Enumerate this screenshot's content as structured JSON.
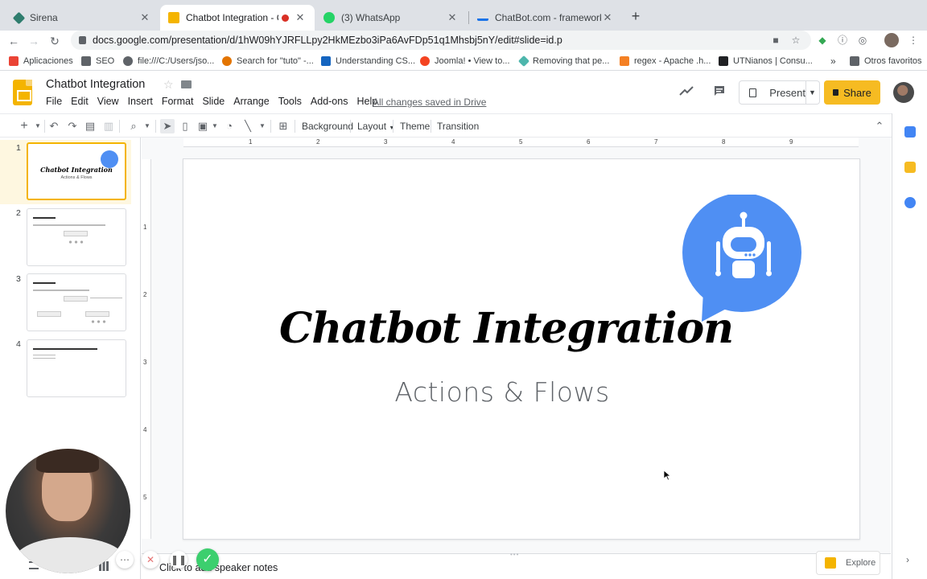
{
  "browser": {
    "tabs": [
      {
        "title": "Sirena",
        "color": "#2f7d6e"
      },
      {
        "title": "Chatbot Integration - Goog",
        "color": "#f4b400"
      },
      {
        "title": "(3) WhatsApp",
        "color": "#25d366"
      },
      {
        "title": "ChatBot.com - framework for c",
        "color": "#1a73e8"
      }
    ],
    "url": "docs.google.com/presentation/d/1hW09hYJRFLLpy2HkMEzbo3iPa6AvFDp51q1Mhsbj5nY/edit#slide=id.p",
    "bookmarks": [
      {
        "label": "Aplicaciones",
        "color": "#ea4335"
      },
      {
        "label": "SEO",
        "color": "#5f6368"
      },
      {
        "label": "file:///C:/Users/jso...",
        "color": "#5f6368"
      },
      {
        "label": "Search for \"tuto\" -...",
        "color": "#e37400"
      },
      {
        "label": "Understanding CS...",
        "color": "#1565c0"
      },
      {
        "label": "Joomla! • View to...",
        "color": "#f44321"
      },
      {
        "label": "Removing that pe...",
        "color": "#4db6ac"
      },
      {
        "label": "regex - Apache .h...",
        "color": "#f48024"
      },
      {
        "label": "UTNianos | Consu...",
        "color": "#202124"
      }
    ],
    "bookmarks_more": "»",
    "other_bookmarks": "Otros favoritos"
  },
  "doc": {
    "title": "Chatbot Integration",
    "menu": [
      "File",
      "Edit",
      "View",
      "Insert",
      "Format",
      "Slide",
      "Arrange",
      "Tools",
      "Add-ons",
      "Help"
    ],
    "saved_status": "All changes saved in Drive",
    "present_label": "Present",
    "share_label": "Share"
  },
  "toolbar": {
    "background": "Background",
    "layout": "Layout",
    "theme": "Theme",
    "transition": "Transition"
  },
  "filmstrip": {
    "numbers": [
      "1",
      "2",
      "3",
      "4"
    ],
    "slide1_title": "Chatbot Integration",
    "slide1_subtitle": "Actions & Flows"
  },
  "rulers": {
    "h": [
      "1",
      "2",
      "3",
      "4",
      "5",
      "6",
      "7",
      "8",
      "9"
    ],
    "v": [
      "1",
      "2",
      "3",
      "4",
      "5"
    ]
  },
  "slide": {
    "title": "Chatbot Integration",
    "subtitle": "Actions & Flows",
    "bot_color": "#4f8ff3"
  },
  "notes": {
    "placeholder": "Click to add speaker notes"
  },
  "explore": {
    "label": "Explore"
  },
  "accent": {
    "slides_yellow": "#f4b400",
    "share_yellow": "#f6bb22"
  }
}
